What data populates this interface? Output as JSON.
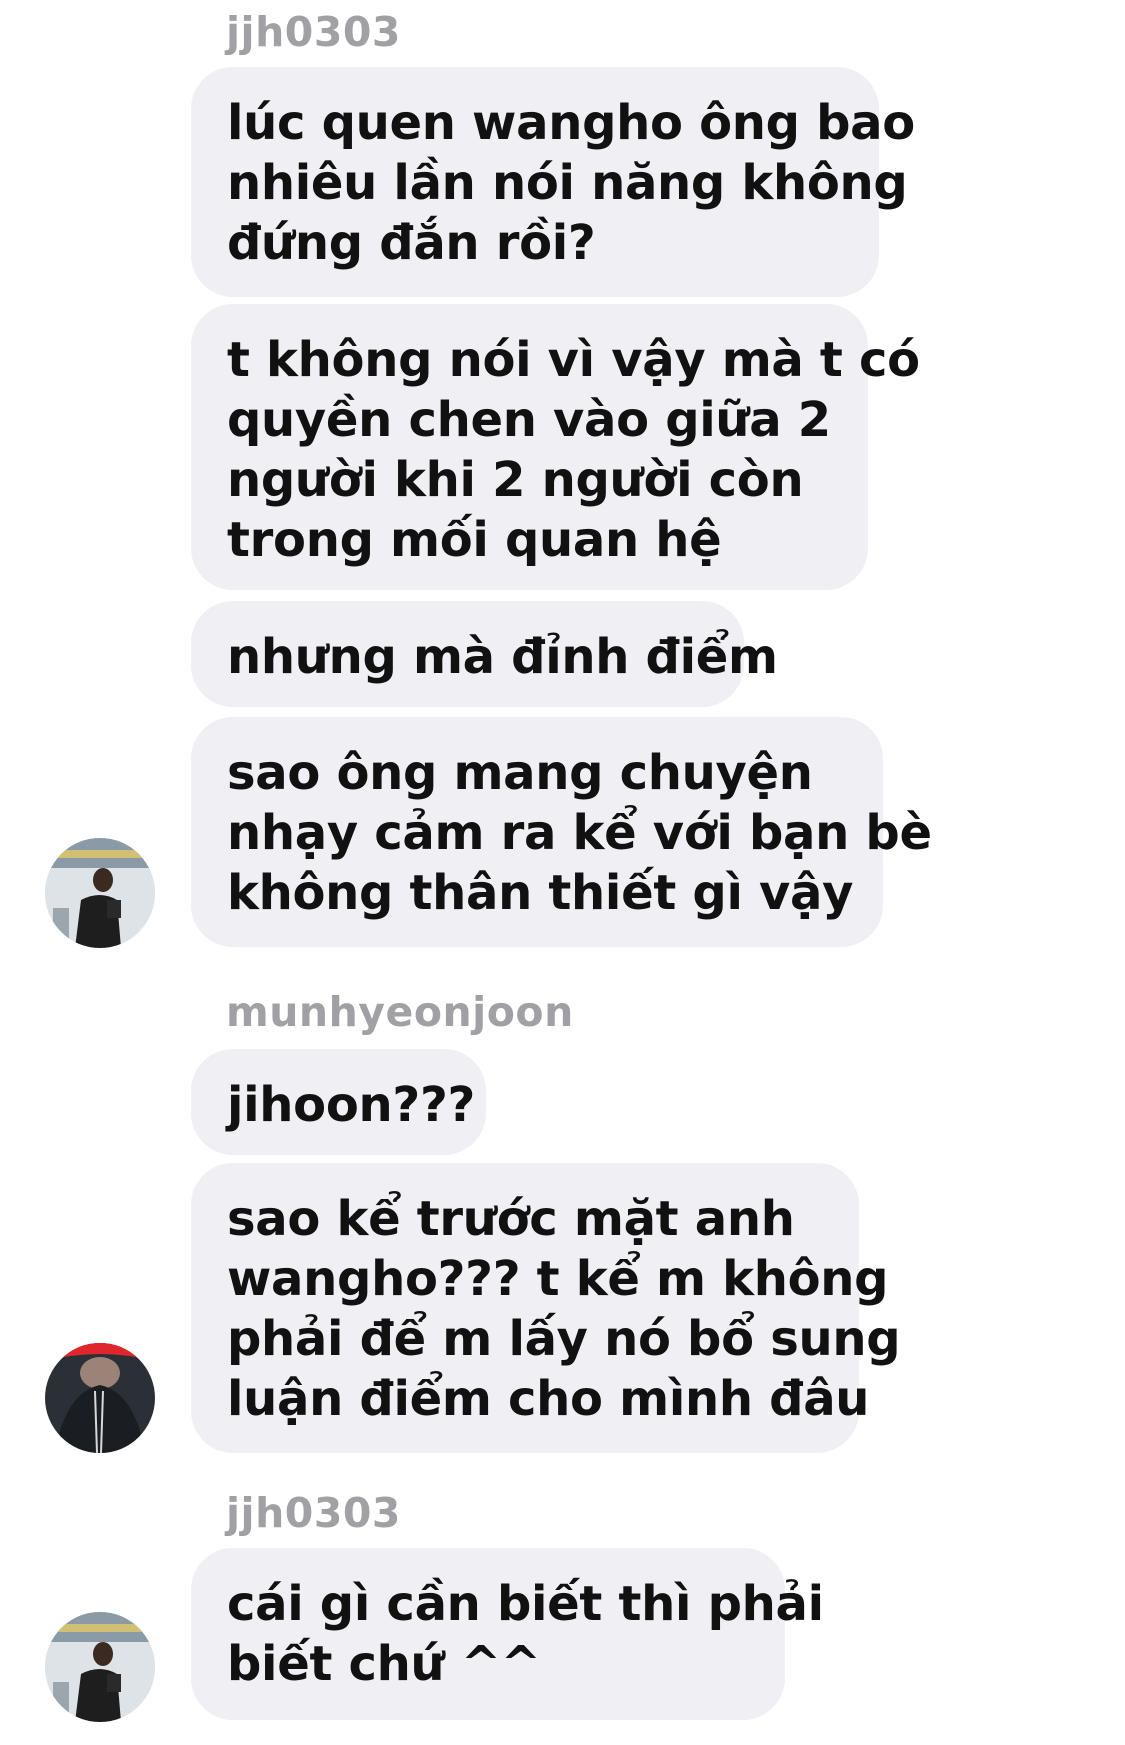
{
  "thread": {
    "groups": [
      {
        "sender": "jjh0303",
        "messages": [
          [
            "lúc quen wangho ông bao",
            "nhiêu lần nói năng không",
            "đứng đắn rồi?"
          ],
          [
            "t không nói vì vậy mà t có",
            "quyền chen vào giữa 2",
            "người khi 2 người còn",
            "trong mối quan hệ"
          ],
          [
            "nhưng mà đỉnh điểm"
          ],
          [
            "sao ông mang chuyện",
            "nhạy cảm ra kể với bạn bè",
            "không thân thiết gì vậy"
          ]
        ],
        "avatar_icon": "user-avatar-jjh0303"
      },
      {
        "sender": "munhyeonjoon",
        "messages": [
          [
            "jihoon???"
          ],
          [
            "sao kể trước mặt anh",
            "wangho??? t kể m không",
            "phải để m lấy nó bổ sung",
            "luận điểm cho mình đâu"
          ]
        ],
        "avatar_icon": "user-avatar-munhyeonjoon"
      },
      {
        "sender": "jjh0303",
        "messages": [
          [
            "cái gì cần biết thì phải",
            "biết chứ ^^"
          ]
        ],
        "avatar_icon": "user-avatar-jjh0303"
      }
    ]
  },
  "colors": {
    "bubble": "#efeff4",
    "text": "#111111",
    "sender": "#a0a0a5",
    "background": "#ffffff"
  }
}
